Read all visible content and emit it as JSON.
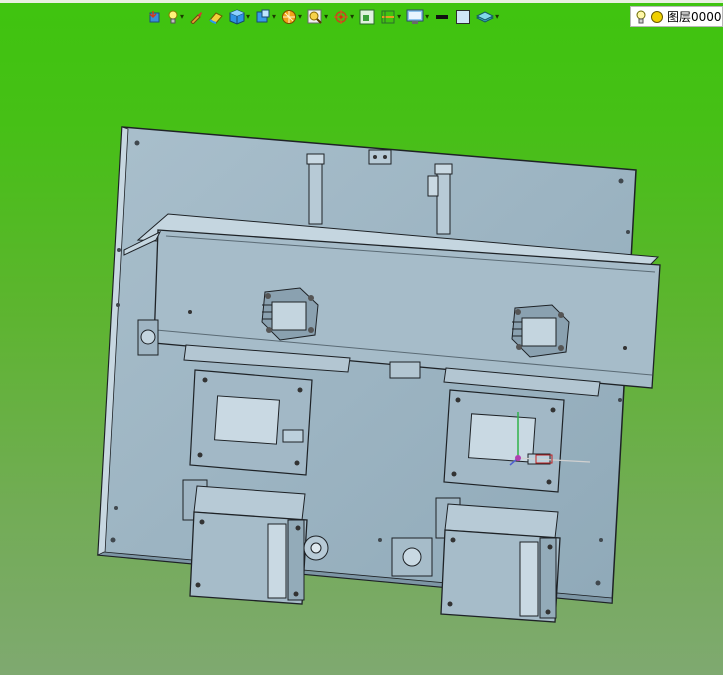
{
  "toolbar": {
    "items": [
      {
        "name": "view-import-icon",
        "has_dropdown": false
      },
      {
        "name": "light-bulb-icon",
        "has_dropdown": true
      },
      {
        "name": "paint-brush-icon",
        "has_dropdown": false
      },
      {
        "name": "eraser-icon",
        "has_dropdown": false
      },
      {
        "name": "cube-shaded-icon",
        "has_dropdown": true
      },
      {
        "name": "cube-view-icon",
        "has_dropdown": true
      },
      {
        "name": "section-sphere-icon",
        "has_dropdown": true
      },
      {
        "name": "zoom-fit-icon",
        "has_dropdown": true
      },
      {
        "name": "rotate-axis-icon",
        "has_dropdown": true
      },
      {
        "name": "display-frame-icon",
        "has_dropdown": false
      },
      {
        "name": "section-plane-icon",
        "has_dropdown": true
      },
      {
        "name": "monitor-icon",
        "has_dropdown": true
      },
      {
        "name": "line-style-icon",
        "has_dropdown": false
      },
      {
        "name": "background-color-icon",
        "has_dropdown": false
      },
      {
        "name": "layer-stack-icon",
        "has_dropdown": true
      }
    ]
  },
  "layer": {
    "label": "图层0000",
    "bulb_color": "#ffe000",
    "state_color": "#f0d000"
  },
  "colors": {
    "viewport_top": "#3fc40f",
    "viewport_bottom": "#7fa970",
    "part_fill": "#9db5c3",
    "part_edge": "#1e2226"
  }
}
